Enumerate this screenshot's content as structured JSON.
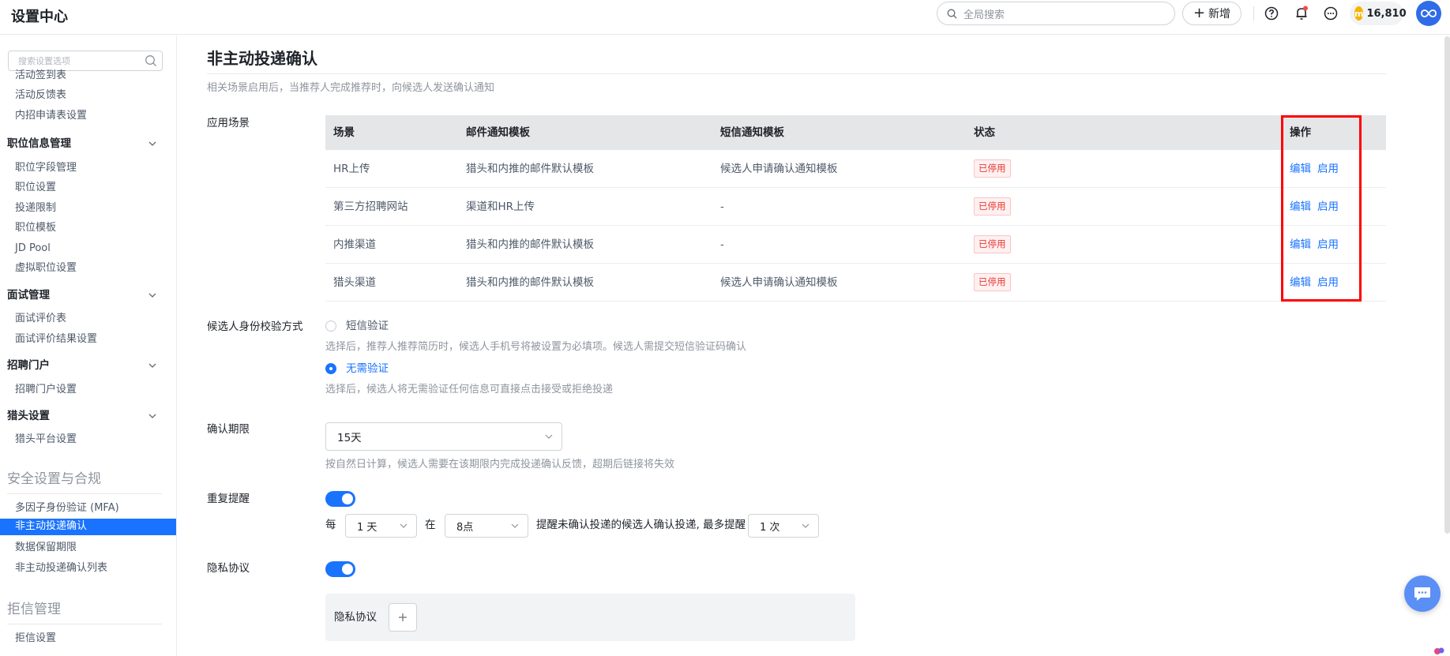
{
  "header": {
    "title": "设置中心",
    "search_placeholder": "全局搜索",
    "new_label": "新增",
    "coin_symbol": "m",
    "coins": "16,810",
    "icons": [
      "help-icon",
      "bell-icon",
      "more-icon",
      "coin-icon",
      "avatar"
    ]
  },
  "sidebar": {
    "search_placeholder": "搜索设置选项",
    "items_top": [
      "活动签到表",
      "活动反馈表",
      "内招申请表设置"
    ],
    "job_group": "职位信息管理",
    "job_items": [
      "职位字段管理",
      "职位设置",
      "投递限制",
      "职位模板",
      "JD Pool",
      "虚拟职位设置"
    ],
    "interview_group": "面试管理",
    "interview_items": [
      "面试评价表",
      "面试评价结果设置"
    ],
    "portal_group": "招聘门户",
    "portal_items": [
      "招聘门户设置"
    ],
    "headhunter_group": "猎头设置",
    "headhunter_items": [
      "猎头平台设置"
    ],
    "security_section": "安全设置与合规",
    "security_items": [
      "多因子身份验证 (MFA)",
      "非主动投递确认",
      "数据保留期限",
      "非主动投递确认列表"
    ],
    "reject_section": "拒信管理",
    "reject_items": [
      "拒信设置"
    ]
  },
  "main": {
    "title": "非主动投递确认",
    "description": "相关场景启用后，当推荐人完成推荐时，向候选人发送确认通知",
    "scene_label": "应用场景",
    "table": {
      "headers": [
        "场景",
        "邮件通知模板",
        "短信通知模板",
        "状态",
        "操作"
      ],
      "rows": [
        {
          "scene": "HR上传",
          "email": "猎头和内推的邮件默认模板",
          "sms": "候选人申请确认通知模板",
          "status": "已停用",
          "edit": "编辑",
          "enable": "启用"
        },
        {
          "scene": "第三方招聘网站",
          "email": "渠道和HR上传",
          "sms": "-",
          "status": "已停用",
          "edit": "编辑",
          "enable": "启用"
        },
        {
          "scene": "内推渠道",
          "email": "猎头和内推的邮件默认模板",
          "sms": "-",
          "status": "已停用",
          "edit": "编辑",
          "enable": "启用"
        },
        {
          "scene": "猎头渠道",
          "email": "猎头和内推的邮件默认模板",
          "sms": "候选人申请确认通知模板",
          "status": "已停用",
          "edit": "编辑",
          "enable": "启用"
        }
      ]
    },
    "identity": {
      "label": "候选人身份校验方式",
      "option_sms": "短信验证",
      "hint_sms": "选择后，推荐人推荐简历时，候选人手机号将被设置为必填项。候选人需提交短信验证码确认",
      "option_none": "无需验证",
      "hint_none": "选择后，候选人将无需验证任何信息可直接点击接受或拒绝投递",
      "selected": "无需验证"
    },
    "deadline": {
      "label": "确认期限",
      "value": "15天",
      "hint": "按自然日计算，候选人需要在该期限内完成投递确认反馈，超期后链接将失效"
    },
    "reminder": {
      "label": "重复提醒",
      "enabled": true,
      "every": "每",
      "interval": "1 天",
      "at": "在",
      "time": "8点",
      "text": "提醒未确认投递的候选人确认投递, 最多提醒",
      "max": "1 次"
    },
    "privacy": {
      "label": "隐私协议",
      "enabled": true,
      "box_label": "隐私协议"
    }
  },
  "colors": {
    "accent": "#1a73ff",
    "disabled_tag": "#e53935",
    "highlight": "#ff0000"
  }
}
